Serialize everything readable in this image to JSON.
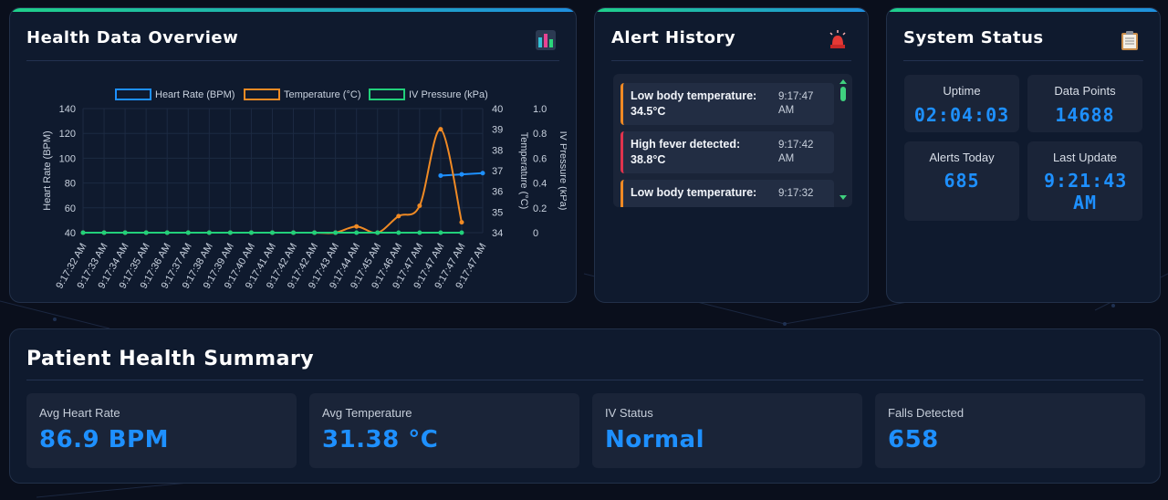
{
  "overview": {
    "title": "Health Data Overview",
    "icon": "bar-chart-icon"
  },
  "chart_data": {
    "type": "line",
    "x": [
      "9:17:32 AM",
      "9:17:33 AM",
      "9:17:34 AM",
      "9:17:35 AM",
      "9:17:36 AM",
      "9:17:37 AM",
      "9:17:38 AM",
      "9:17:39 AM",
      "9:17:40 AM",
      "9:17:41 AM",
      "9:17:42 AM",
      "9:17:42 AM",
      "9:17:43 AM",
      "9:17:44 AM",
      "9:17:45 AM",
      "9:17:46 AM",
      "9:17:47 AM",
      "9:17:47 AM",
      "9:17:47 AM",
      "9:17:47 AM"
    ],
    "series": [
      {
        "name": "Heart Rate (BPM)",
        "axis": "left",
        "color": "#1e90ff",
        "values": [
          null,
          null,
          null,
          null,
          null,
          null,
          null,
          null,
          null,
          null,
          null,
          null,
          null,
          null,
          null,
          null,
          null,
          86,
          87,
          88
        ]
      },
      {
        "name": "Temperature (°C)",
        "axis": "right",
        "color": "#f08a24",
        "values": [
          34,
          34,
          34,
          34,
          34,
          34,
          34,
          34,
          34,
          34,
          34,
          34,
          34,
          34.3,
          34,
          34.8,
          35.3,
          39,
          34.5,
          null
        ]
      },
      {
        "name": "IV Pressure (kPa)",
        "axis": "right2",
        "color": "#22d07a",
        "values": [
          0,
          0,
          0,
          0,
          0,
          0,
          0,
          0,
          0,
          0,
          0,
          0,
          0,
          0,
          0,
          0,
          0,
          0,
          0,
          null
        ]
      }
    ],
    "ylabel": "Heart Rate (BPM)",
    "y2label": "Temperature (°C)",
    "y3label": "IV Pressure (kPa)",
    "ylim": [
      40,
      140
    ],
    "y2lim": [
      34,
      40
    ],
    "y3lim": [
      0,
      1.0
    ],
    "yticks": [
      "140",
      "120",
      "100",
      "80",
      "60",
      "40"
    ],
    "y2ticks": [
      "40",
      "39",
      "38",
      "37",
      "36",
      "35",
      "34"
    ],
    "y3ticks": [
      "1.0",
      "0.8",
      "0.6",
      "0.4",
      "0.2",
      "0"
    ],
    "grid": true,
    "legend": "top"
  },
  "alerts": {
    "title": "Alert History",
    "icon": "siren-icon",
    "items": [
      {
        "message": "Low body temperature: 34.5°C",
        "time": "9:17:47 AM",
        "level": "warning"
      },
      {
        "message": "High fever detected: 38.8°C",
        "time": "9:17:42 AM",
        "level": "danger"
      },
      {
        "message": "Low body temperature:",
        "time": "9:17:32",
        "level": "warning"
      }
    ]
  },
  "status": {
    "title": "System Status",
    "icon": "clipboard-icon",
    "tiles": [
      {
        "label": "Uptime",
        "value": "02:04:03"
      },
      {
        "label": "Data Points",
        "value": "14688"
      },
      {
        "label": "Alerts Today",
        "value": "685"
      },
      {
        "label": "Last Update",
        "value": "9:21:43 AM"
      }
    ]
  },
  "summary": {
    "title": "Patient Health Summary",
    "tiles": [
      {
        "label": "Avg Heart Rate",
        "value": "86.9 BPM"
      },
      {
        "label": "Avg Temperature",
        "value": "31.38 °C"
      },
      {
        "label": "IV Status",
        "value": "Normal"
      },
      {
        "label": "Falls Detected",
        "value": "658"
      }
    ]
  },
  "colors": {
    "accent": "#1e90ff",
    "warning": "#f08a24",
    "danger": "#e0334d",
    "ok": "#22d07a"
  }
}
